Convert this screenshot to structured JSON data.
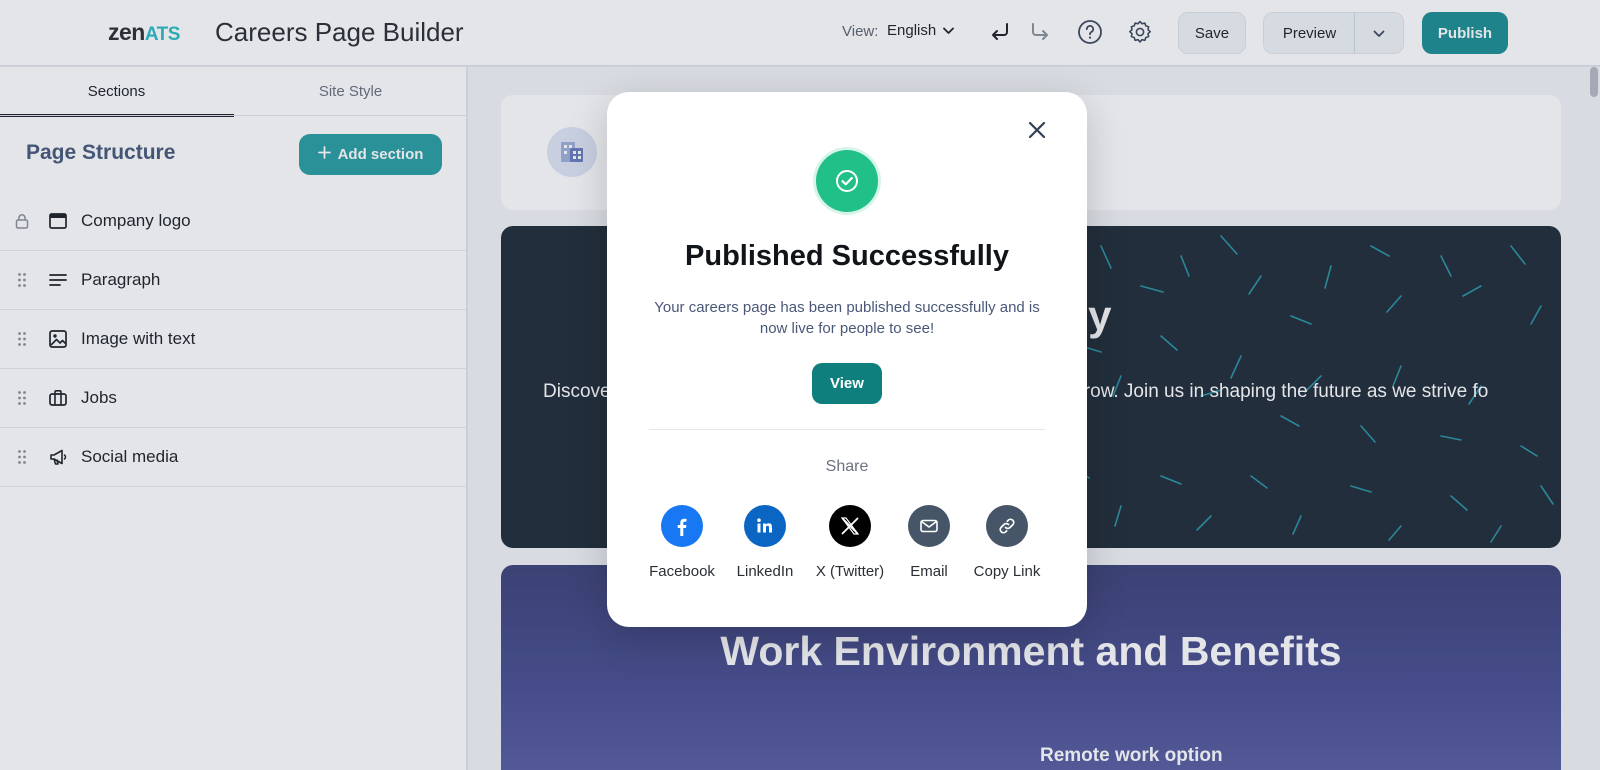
{
  "header": {
    "logo_main": "zen",
    "logo_suffix": "ATS",
    "title": "Careers Page Builder",
    "view_label": "View:",
    "view_value": "English",
    "save_label": "Save",
    "preview_label": "Preview",
    "publish_label": "Publish",
    "icons": [
      "undo-icon",
      "redo-icon",
      "help-icon",
      "gear-icon",
      "chevron-down-icon"
    ]
  },
  "sidebar": {
    "tabs": [
      {
        "label": "Sections",
        "active": true
      },
      {
        "label": "Site Style",
        "active": false
      }
    ],
    "structure_title": "Page Structure",
    "add_section_label": "Add section",
    "items": [
      {
        "label": "Company logo",
        "icon": "browser-window-icon",
        "locked": true
      },
      {
        "label": "Paragraph",
        "icon": "paragraph-icon",
        "locked": false
      },
      {
        "label": "Image with text",
        "icon": "image-icon",
        "locked": false
      },
      {
        "label": "Jobs",
        "icon": "briefcase-icon",
        "locked": false
      },
      {
        "label": "Social media",
        "icon": "megaphone-icon",
        "locked": false
      }
    ]
  },
  "canvas": {
    "hero_title": "ompany",
    "hero_text": "Discove                                                                                    collective impact. We're passionate about working                                                                                 omorrow. Join us in shaping the future as we strive fo",
    "env_title": "Work Environment and Benefits",
    "env_subtitle": "Remote work option"
  },
  "modal": {
    "title": "Published Successfully",
    "description": "Your careers page has been published successfully and is now live for people to see!",
    "view_label": "View",
    "share_label": "Share",
    "share_options": [
      {
        "label": "Facebook",
        "icon": "facebook-icon",
        "color": "#1877f2"
      },
      {
        "label": "LinkedIn",
        "icon": "linkedin-icon",
        "color": "#0a66c2"
      },
      {
        "label": "X (Twitter)",
        "icon": "x-twitter-icon",
        "color": "#000000"
      },
      {
        "label": "Email",
        "icon": "email-icon",
        "color": "#475569"
      },
      {
        "label": "Copy Link",
        "icon": "link-icon",
        "color": "#475569"
      }
    ]
  },
  "colors": {
    "accent": "#1d8f93",
    "success": "#21c089",
    "view_button": "#0e7f7d"
  }
}
